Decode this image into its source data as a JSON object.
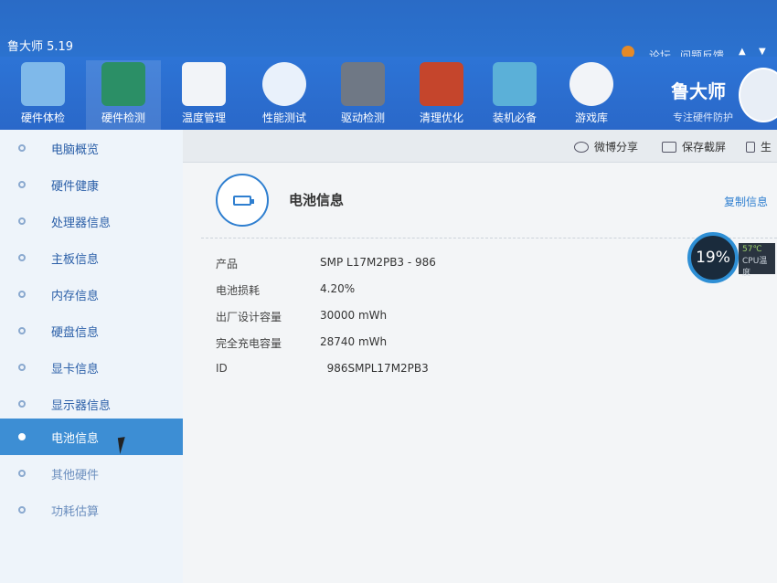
{
  "app": {
    "title": "鲁大师 5.19"
  },
  "top_links": [
    "论坛",
    "问题反馈"
  ],
  "toolbar": [
    {
      "label": "硬件体检",
      "icon": "monitor-icon",
      "active": false
    },
    {
      "label": "硬件检测",
      "icon": "motherboard-icon",
      "active": true
    },
    {
      "label": "温度管理",
      "icon": "thermometer-icon",
      "active": false
    },
    {
      "label": "性能测试",
      "icon": "speedometer-icon",
      "active": false
    },
    {
      "label": "驱动检测",
      "icon": "gear-icon",
      "active": false
    },
    {
      "label": "清理优化",
      "icon": "broom-icon",
      "active": false
    },
    {
      "label": "装机必备",
      "icon": "cube-icon",
      "active": false
    },
    {
      "label": "游戏库",
      "icon": "gamepad-icon",
      "active": false
    }
  ],
  "brand": {
    "name": "鲁大师",
    "slogan": "专注硬件防护"
  },
  "sidebar": [
    {
      "label": "电脑概览"
    },
    {
      "label": "硬件健康"
    },
    {
      "label": "处理器信息"
    },
    {
      "label": "主板信息"
    },
    {
      "label": "内存信息"
    },
    {
      "label": "硬盘信息"
    },
    {
      "label": "显卡信息"
    },
    {
      "label": "显示器信息"
    },
    {
      "label": "电池信息"
    },
    {
      "label": "其他硬件"
    },
    {
      "label": "功耗估算"
    }
  ],
  "actions": {
    "share": "微博分享",
    "screenshot": "保存截屏",
    "generate": "生"
  },
  "section": {
    "title": "电池信息",
    "copy": "复制信息"
  },
  "battery": [
    {
      "key": "产品",
      "value": "SMP L17M2PB3 -   986"
    },
    {
      "key": "电池损耗",
      "value": "4.20%"
    },
    {
      "key": "出厂设计容量",
      "value": "30000 mWh"
    },
    {
      "key": "完全充电容量",
      "value": "28740 mWh"
    },
    {
      "key": "ID",
      "value": "  986SMPL17M2PB3"
    }
  ],
  "monitor": {
    "usage": "19%",
    "temp": "57℃",
    "label": "CPU温度"
  },
  "colors": {
    "accent": "#2f7fd0",
    "toolbar": "#2a6bc6",
    "active_nav": "#3d8ed4"
  }
}
